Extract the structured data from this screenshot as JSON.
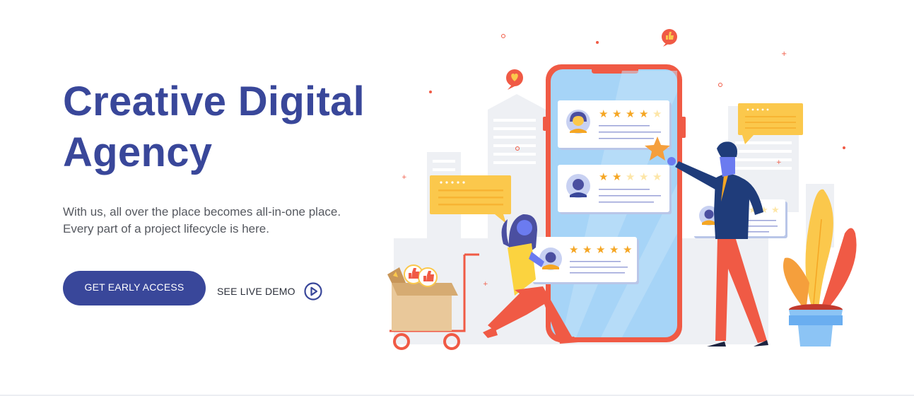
{
  "hero": {
    "title_line1": "Creative Digital",
    "title_line2": "Agency",
    "subtitle_line1": "With us, all over the place becomes all-in-one place.",
    "subtitle_line2": "Every part of a project lifecycle is here."
  },
  "cta": {
    "primary_label": "GET EARLY ACCESS",
    "demo_label": "SEE LIVE DEMO",
    "demo_icon": "play-circle-icon"
  },
  "illustration": {
    "review_cards": [
      {
        "rating": 4,
        "max": 5
      },
      {
        "rating": 2,
        "max": 5
      },
      {
        "rating": 5,
        "max": 5
      },
      {
        "rating": 2,
        "max": 5
      }
    ]
  },
  "colors": {
    "brand": "#39479a",
    "text": "#55585f",
    "accent_red": "#f05a45",
    "accent_yellow": "#fbc84c",
    "phone_screen": "#a6d4f7"
  }
}
